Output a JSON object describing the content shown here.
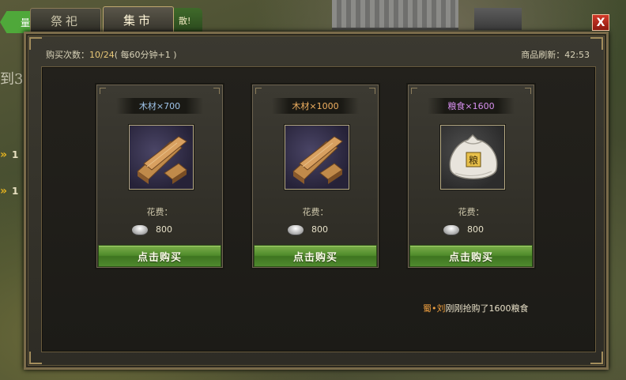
{
  "background": {
    "banner_text": "量",
    "left_text": "到3(",
    "arrow_counts": [
      "1",
      "1"
    ]
  },
  "tabs": [
    {
      "label": "祭祀"
    },
    {
      "label": "集市"
    }
  ],
  "tab_tail": "散!",
  "close_label": "X",
  "market": {
    "purchase_label": "购买次数：",
    "purchase_value": "10/24",
    "purchase_note": "( 每60分钟+1 )",
    "refresh_label": "商品刷新：",
    "refresh_time": "42:53"
  },
  "items": [
    {
      "name": "木材×700",
      "icon": "wood-icon",
      "cost_label": "花费：",
      "cost_value": "800",
      "currency_icon": "silver-icon",
      "button": "点击购买"
    },
    {
      "name": "木材×1000",
      "icon": "wood-icon",
      "cost_label": "花费：",
      "cost_value": "800",
      "currency_icon": "silver-icon",
      "button": "点击购买"
    },
    {
      "name": "粮食×1600",
      "icon": "grain-sack-icon",
      "cost_label": "花费：",
      "cost_value": "800",
      "currency_icon": "silver-icon",
      "button": "点击购买"
    }
  ],
  "sack_glyph": "粮",
  "ticker": {
    "player": "蜀•刘",
    "message": "刚刚抢购了1600粮食"
  },
  "colors": {
    "button_green": "#4e8a2a",
    "name_blue": "#9fc4ea",
    "name_orange": "#f0b060",
    "name_purple": "#d890f0",
    "accent_gold": "#e8c878"
  }
}
